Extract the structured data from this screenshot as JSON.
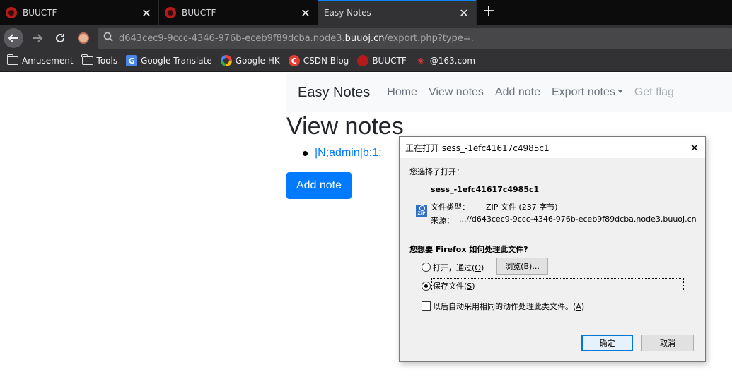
{
  "browser": {
    "tabs": [
      {
        "title": "BUUCTF",
        "active": false
      },
      {
        "title": "BUUCTF",
        "active": false
      },
      {
        "title": "Easy Notes",
        "active": true
      }
    ],
    "tab_close_glyph": "✕",
    "new_tab_glyph": "+",
    "url_prefix": "d643cec9-9ccc-4346-976b-eceb9f89dcba.node3.",
    "url_domain": "buuoj.cn",
    "url_suffix": "/export.php?type=.",
    "bookmarks": [
      {
        "label": "Amusement",
        "icon": "folder-icon"
      },
      {
        "label": "Tools",
        "icon": "folder-icon"
      },
      {
        "label": "Google Translate",
        "icon": "google-translate-icon"
      },
      {
        "label": "Google HK",
        "icon": "google-icon"
      },
      {
        "label": "CSDN Blog",
        "icon": "csdn-icon"
      },
      {
        "label": "BUUCTF",
        "icon": "buuctf-icon"
      },
      {
        "label": "@163.com",
        "icon": "netease-icon"
      }
    ]
  },
  "site": {
    "brand": "Easy Notes",
    "nav": [
      {
        "label": "Home"
      },
      {
        "label": "View notes"
      },
      {
        "label": "Add note"
      },
      {
        "label": "Export notes"
      },
      {
        "label": "Get flag"
      }
    ],
    "page_title": "View notes",
    "notes": [
      "|N;admin|b:1;"
    ],
    "add_note_label": "Add note"
  },
  "dialog": {
    "title": "正在打开 sess_-1efc41617c4985c1",
    "close_glyph": "✕",
    "you_chose": "您选择了打开：",
    "file_name": "sess_-1efc41617c4985c1",
    "type_label": "文件类型：",
    "type_value": "ZIP 文件 (237 字节)",
    "source_label": "来源：",
    "source_value": "...//d643cec9-9ccc-4346-976b-eceb9f89dcba.node3.buuoj.cn",
    "question": "您想要 Firefox 如何处理此文件?",
    "open_with_label": "打开，通过(",
    "open_with_key": "O",
    "browse_label": "浏览(",
    "browse_key": "B",
    "browse_suffix": ")...",
    "save_label": "保存文件(",
    "save_key": "S",
    "auto_label": "以后自动采用相同的动作处理此类文件。(",
    "auto_key": "A",
    "close_paren": ")",
    "ok_label": "确定",
    "cancel_label": "取消",
    "selected_option": "save",
    "auto_checked": false
  }
}
